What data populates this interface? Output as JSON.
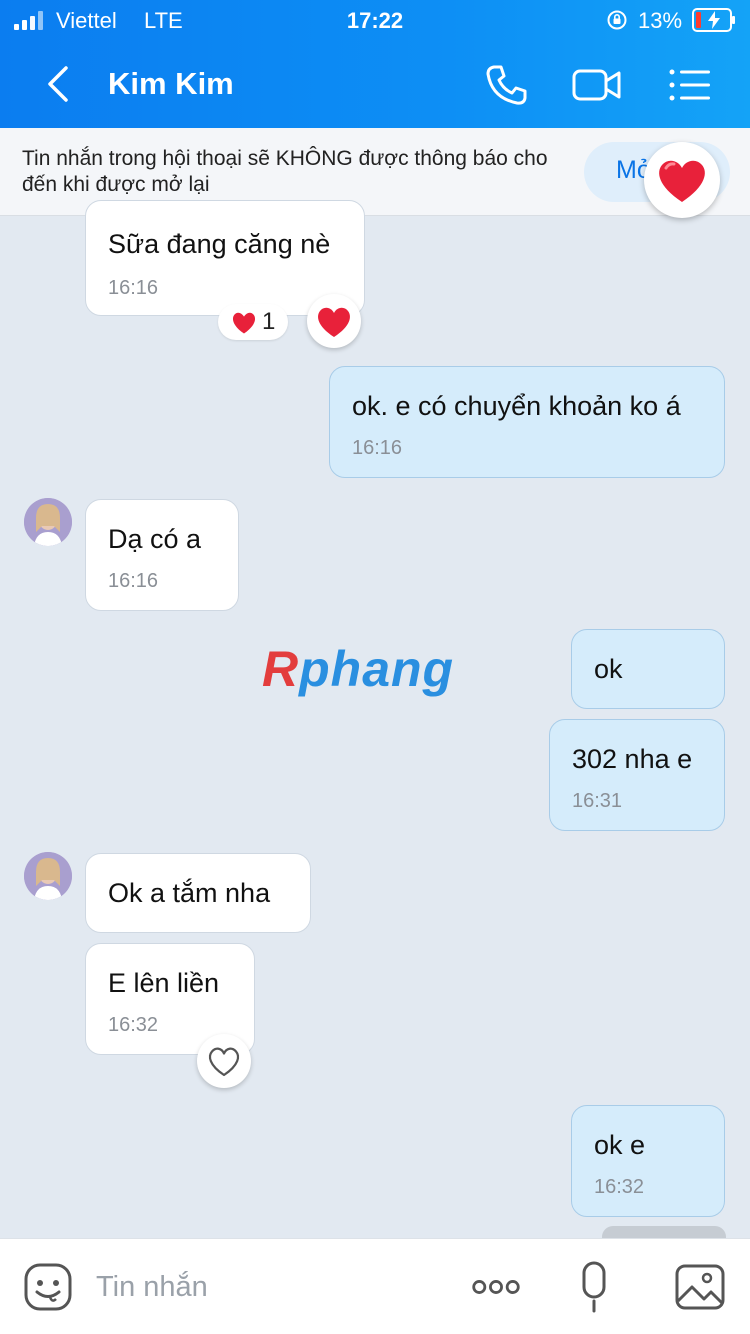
{
  "status_bar": {
    "carrier": "Viettel",
    "network": "LTE",
    "time": "17:22",
    "battery": "13%"
  },
  "header": {
    "back_icon": "chevron-left-icon",
    "contact_name": "Kim Kim",
    "actions": [
      "phone-icon",
      "video-call-icon",
      "menu-list-icon"
    ]
  },
  "notice": {
    "text": "Tin nhắn trong hội thoại sẽ KHÔNG được thông báo cho đến khi được mở lại",
    "button_label": "Mở"
  },
  "messages": [
    {
      "dir": "in",
      "text": "Sữa đang căng nè",
      "time": "16:16",
      "reaction": {
        "icon": "heart-icon",
        "count": "1"
      }
    },
    {
      "dir": "out",
      "text": "ok. e có chuyển khoản ko á",
      "time": "16:16"
    },
    {
      "dir": "in",
      "text": "Dạ có a",
      "time": "16:16"
    },
    {
      "dir": "out",
      "text": "ok"
    },
    {
      "dir": "out",
      "text": "302 nha e",
      "time": "16:31"
    },
    {
      "dir": "in",
      "text": "Ok a tắm nha"
    },
    {
      "dir": "in",
      "text": "E lên liền",
      "time": "16:32"
    },
    {
      "dir": "out",
      "text": "ok e",
      "time": "16:32"
    }
  ],
  "watermark": {
    "part1": "R",
    "part2": "phang"
  },
  "composer": {
    "placeholder": "Tin nhắn",
    "icons": [
      "emoji-icon",
      "more-dots-icon",
      "microphone-icon",
      "image-icon"
    ]
  },
  "colors": {
    "header_blue": "#0b7df0",
    "outgoing_bubble": "#d5ecfb",
    "incoming_bubble": "#ffffff",
    "chat_background": "#e2e9f1",
    "heart_red": "#e8213a"
  }
}
